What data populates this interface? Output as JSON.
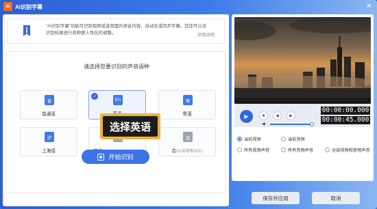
{
  "app": {
    "logo_text": "ai",
    "title": "AI识别字幕",
    "close": "✕"
  },
  "info": {
    "line1": "“AI识别字幕”功能可识别视频或音频里的语音内容，自动生成同步字幕。您还可以对",
    "line2": "识别结果进行各种更人性化的调整。",
    "link": "详情说明"
  },
  "selector": {
    "title": "请选择您要识别的声音语种",
    "languages": [
      {
        "icon": "普",
        "label": "普通话",
        "sub": ""
      },
      {
        "icon": "En",
        "label": "英语",
        "sub": ""
      },
      {
        "icon": "粤",
        "label": "粤语",
        "sub": ""
      },
      {
        "icon": "沪",
        "label": "上海话",
        "sub": ""
      },
      {
        "icon": "",
        "label": "其他",
        "sub": ""
      },
      {
        "icon": "混",
        "label": "合",
        "sub": "(中英粤等并存)"
      }
    ]
  },
  "tooltip": "选择英语",
  "start_button": "开始识别",
  "player": {
    "time_current": "00:00:00.000",
    "time_total": "00:00:45.000",
    "volume_level": 0.9
  },
  "options": [
    {
      "label": "当前视频",
      "selected": true
    },
    {
      "label": "当前音频",
      "selected": false
    },
    {
      "label": "所有视频声音",
      "selected": false
    },
    {
      "label": "所有音频声音",
      "selected": false
    },
    {
      "label": "全部视频和音频声音",
      "selected": false
    }
  ],
  "buttons": {
    "save": "保存并应用",
    "cancel": "取消"
  },
  "colors": {
    "accent": "#2f66e3",
    "tooltip_border": "#f3b13d"
  }
}
